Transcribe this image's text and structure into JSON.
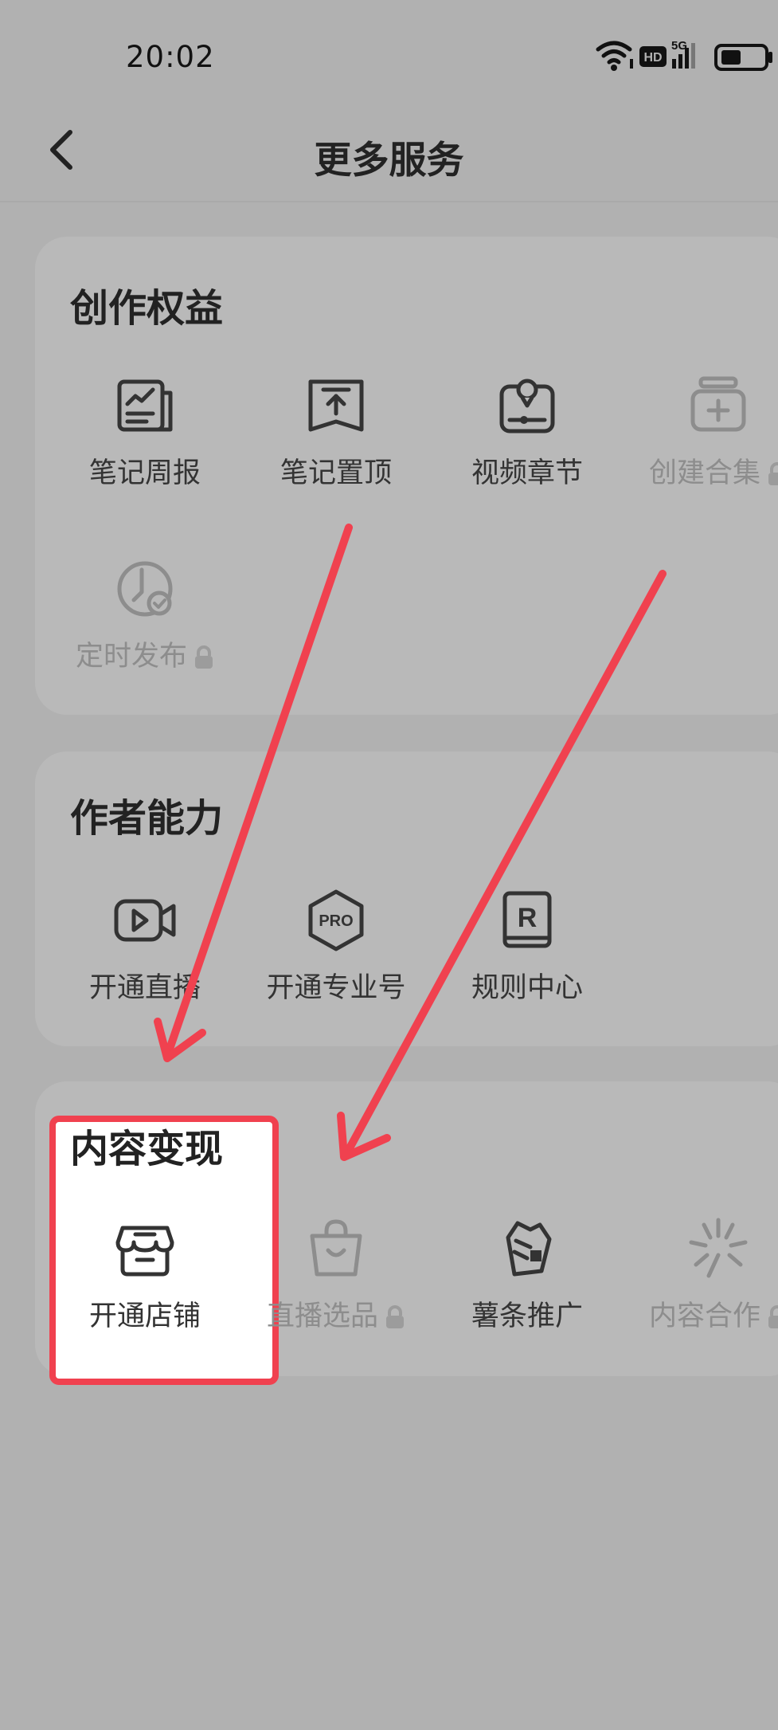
{
  "status": {
    "time": "20:02",
    "hd_label": "HD",
    "network_label": "5G"
  },
  "header": {
    "title": "更多服务"
  },
  "sections": [
    {
      "title": "创作权益",
      "items": [
        {
          "label": "笔记周报",
          "icon": "weekly-report-icon",
          "locked": false
        },
        {
          "label": "笔记置顶",
          "icon": "pin-top-icon",
          "locked": false
        },
        {
          "label": "视频章节",
          "icon": "video-chapter-icon",
          "locked": false
        },
        {
          "label": "创建合集",
          "icon": "create-collection-icon",
          "locked": true
        },
        {
          "label": "定时发布",
          "icon": "scheduled-publish-icon",
          "locked": true
        }
      ]
    },
    {
      "title": "作者能力",
      "items": [
        {
          "label": "开通直播",
          "icon": "live-camera-icon",
          "locked": false
        },
        {
          "label": "开通专业号",
          "icon": "pro-badge-icon",
          "locked": false
        },
        {
          "label": "规则中心",
          "icon": "rule-book-icon",
          "locked": false
        }
      ]
    },
    {
      "title": "内容变现",
      "items": [
        {
          "label": "开通店铺",
          "icon": "shop-icon",
          "locked": false
        },
        {
          "label": "直播选品",
          "icon": "shopping-bag-icon",
          "locked": true
        },
        {
          "label": "薯条推广",
          "icon": "fries-promo-icon",
          "locked": false
        },
        {
          "label": "内容合作",
          "icon": "sparkle-icon",
          "locked": true
        }
      ]
    }
  ],
  "colors": {
    "background": "#b1b1b1",
    "card": "#b9b9b9",
    "annotation": "#f0414f",
    "highlight_fill": "#ffffff"
  }
}
